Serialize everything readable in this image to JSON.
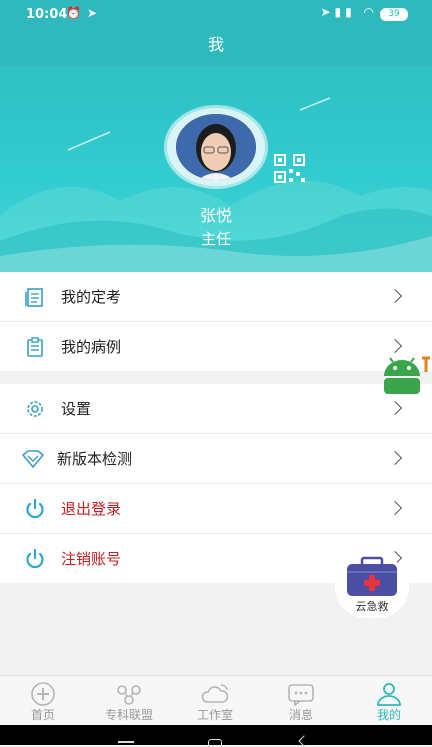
{
  "status_bar": {
    "time": "10:04",
    "battery": "39"
  },
  "header": {
    "title": "我"
  },
  "profile": {
    "name": "张悦",
    "title": "主任"
  },
  "menu": {
    "group1": [
      {
        "label": "我的定考",
        "icon": "exam-book-icon"
      },
      {
        "label": "我的病例",
        "icon": "clipboard-icon"
      }
    ],
    "group2": [
      {
        "label": "设置",
        "icon": "gear-icon"
      },
      {
        "label": "新版本检测",
        "icon": "diamond-icon"
      },
      {
        "label": "退出登录",
        "icon": "power-icon",
        "color": "#c41f1f"
      },
      {
        "label": "注销账号",
        "icon": "power-icon",
        "color": "#c41f1f"
      }
    ]
  },
  "floating": {
    "rescue_label": "云急救"
  },
  "tabs": [
    {
      "label": "首页",
      "icon": "home-icon",
      "active": false
    },
    {
      "label": "专科联盟",
      "icon": "alliance-icon",
      "active": false
    },
    {
      "label": "工作室",
      "icon": "cloud-icon",
      "active": false
    },
    {
      "label": "消息",
      "icon": "message-icon",
      "active": false
    },
    {
      "label": "我的",
      "icon": "user-icon",
      "active": true
    }
  ],
  "colors": {
    "accent": "#2fb9bd",
    "danger": "#c41f1f",
    "rescue_box": "#4b4fa3"
  }
}
